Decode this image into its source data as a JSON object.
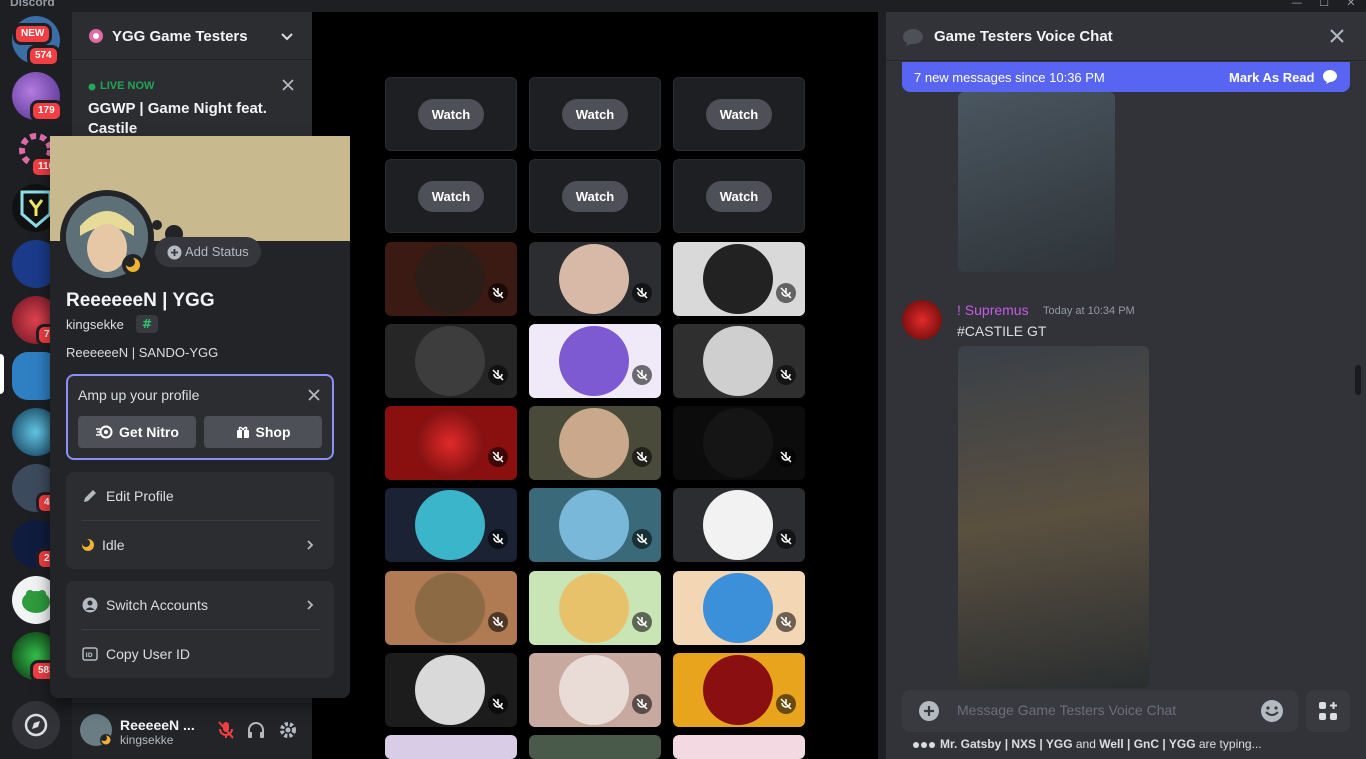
{
  "app": {
    "brand": "Discord"
  },
  "window": {
    "minimize": "—",
    "maximize": "☐",
    "close": "✕"
  },
  "rail": {
    "badges": [
      {
        "text": "NEW"
      },
      {
        "text": "574"
      },
      {
        "text": "179"
      },
      {
        "text": "110"
      },
      {
        "text": "7"
      },
      {
        "text": "4"
      },
      {
        "text": "2"
      },
      {
        "text": "583"
      }
    ]
  },
  "guild": {
    "name": "YGG Game Testers"
  },
  "live": {
    "label": "LIVE NOW",
    "title": "GGWP | Game Night feat. Castile"
  },
  "profile": {
    "display_name": "ReeeeeeN | YGG",
    "username": "kingsekke",
    "bio": "ReeeeeeN | SANDO-YGG",
    "add_status": "Add Status",
    "amp_text": "Amp up your profile",
    "get_nitro": "Get Nitro",
    "shop": "Shop",
    "edit_profile": "Edit Profile",
    "status": "Idle",
    "switch_accounts": "Switch Accounts",
    "copy_user_id": "Copy User ID"
  },
  "user_panel": {
    "name": "ReeeeeN ...",
    "username": "kingsekke"
  },
  "stage": {
    "watch_label": "Watch"
  },
  "chat": {
    "title": "Game Testers Voice Chat",
    "new_messages": "7 new messages since 10:36 PM",
    "mark_as_read": "Mark As Read",
    "message": {
      "author": "! Supremus",
      "time": "Today at 10:34 PM",
      "text": "#CASTILE GT"
    },
    "input_placeholder": "Message Game Testers Voice Chat",
    "typing_user1": "Mr. Gatsby | NXS | YGG",
    "typing_and": " and ",
    "typing_user2": "Well | GnC | YGG",
    "typing_suffix": " are typing..."
  },
  "colors": {
    "accent": "#5865f2",
    "live": "#23a55a",
    "badge": "#f23f43",
    "author": "#c65ce5",
    "banner": "#c9b98e"
  }
}
